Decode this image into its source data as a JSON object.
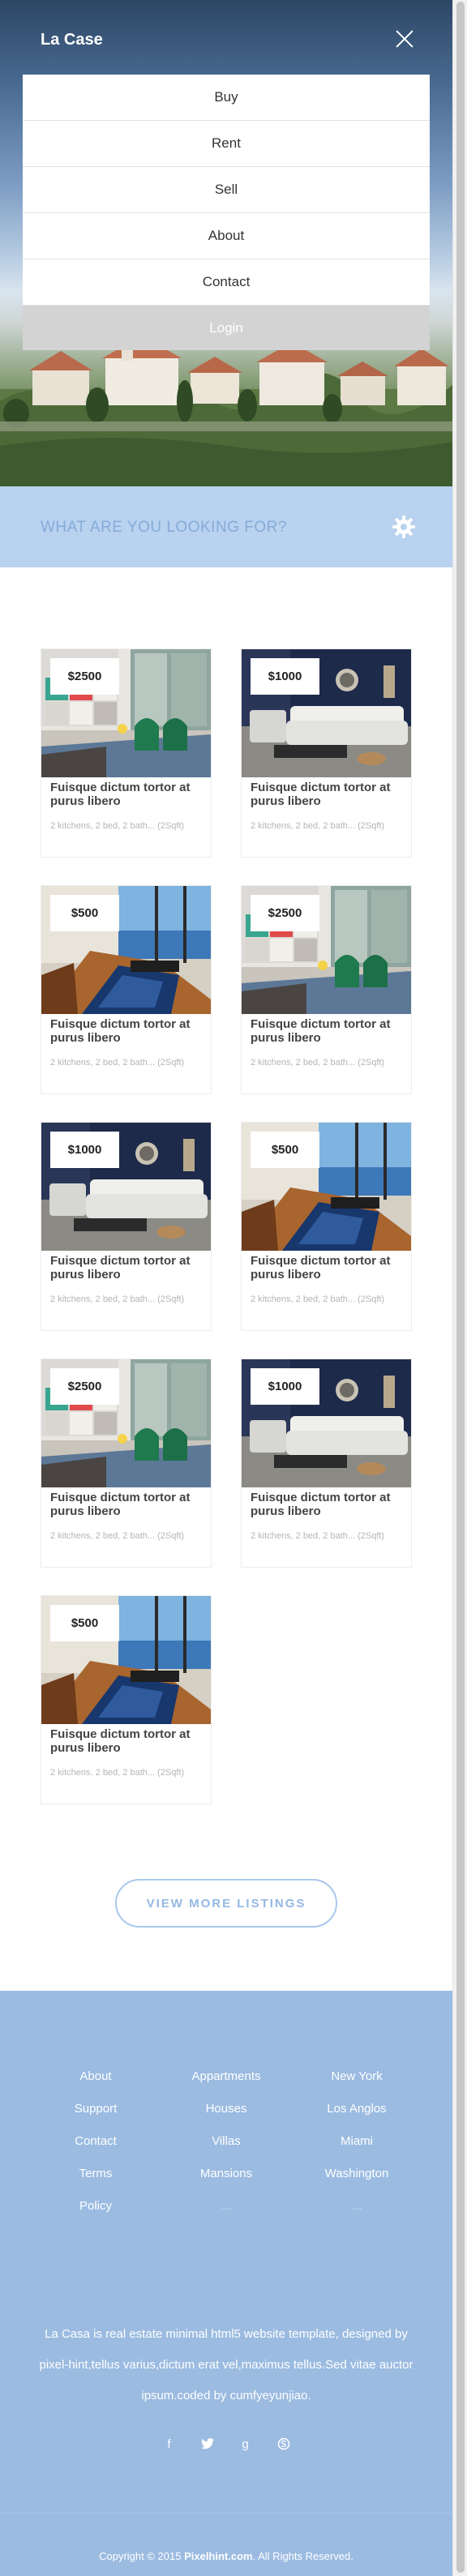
{
  "header": {
    "brand": "La Case"
  },
  "menu": {
    "items": [
      "Buy",
      "Rent",
      "Sell",
      "About",
      "Contact"
    ],
    "login": "Login"
  },
  "search": {
    "label": "WHAT ARE YOU LOOKING FOR?"
  },
  "listings": [
    {
      "price": "$2500",
      "title": "Fuisque dictum tortor at purus libero",
      "desc": "2 kitchens, 2 bed, 2 bath... (2Sqft)",
      "photo": "colorful-living-room"
    },
    {
      "price": "$1000",
      "title": "Fuisque dictum tortor at purus libero",
      "desc": "2 kitchens, 2 bed, 2 bath... (2Sqft)",
      "photo": "navy-living-room"
    },
    {
      "price": "$500",
      "title": "Fuisque dictum tortor at purus libero",
      "desc": "2 kitchens, 2 bed, 2 bath... (2Sqft)",
      "photo": "sea-view-room"
    },
    {
      "price": "$2500",
      "title": "Fuisque dictum tortor at purus libero",
      "desc": "2 kitchens, 2 bed, 2 bath... (2Sqft)",
      "photo": "colorful-living-room"
    },
    {
      "price": "$1000",
      "title": "Fuisque dictum tortor at purus libero",
      "desc": "2 kitchens, 2 bed, 2 bath... (2Sqft)",
      "photo": "navy-living-room"
    },
    {
      "price": "$500",
      "title": "Fuisque dictum tortor at purus libero",
      "desc": "2 kitchens, 2 bed, 2 bath... (2Sqft)",
      "photo": "sea-view-room"
    },
    {
      "price": "$2500",
      "title": "Fuisque dictum tortor at purus libero",
      "desc": "2 kitchens, 2 bed, 2 bath... (2Sqft)",
      "photo": "colorful-living-room"
    },
    {
      "price": "$1000",
      "title": "Fuisque dictum tortor at purus libero",
      "desc": "2 kitchens, 2 bed, 2 bath... (2Sqft)",
      "photo": "navy-living-room"
    },
    {
      "price": "$500",
      "title": "Fuisque dictum tortor at purus libero",
      "desc": "2 kitchens, 2 bed, 2 bath... (2Sqft)",
      "photo": "sea-view-room"
    }
  ],
  "view_more": "VIEW MORE LISTINGS",
  "footer": {
    "col1": [
      "About",
      "Support",
      "Contact",
      "Terms",
      "Policy"
    ],
    "col2": [
      "Appartments",
      "Houses",
      "Villas",
      "Mansions",
      "...."
    ],
    "col3": [
      "New York",
      "Los Anglos",
      "Miami",
      "Washington",
      "...."
    ],
    "about": "La Casa is real estate minimal html5 website template, designed by pixel-hint,tellus varius,dictum erat vel,maximus tellus.Sed vitae auctor ipsum.coded by cumfyeyunjiao.",
    "socials": [
      "facebook-icon",
      "twitter-icon",
      "google-plus-icon",
      "skype-icon"
    ],
    "copyright_prefix": "Copyright © 2015",
    "copyright_brand": "Pixelhint.com",
    "copyright_suffix": ". All Rights Reserved."
  },
  "colors": {
    "accent": "#9bbbe1",
    "search_bg": "#b8d2ef",
    "search_text": "#86abd9"
  }
}
